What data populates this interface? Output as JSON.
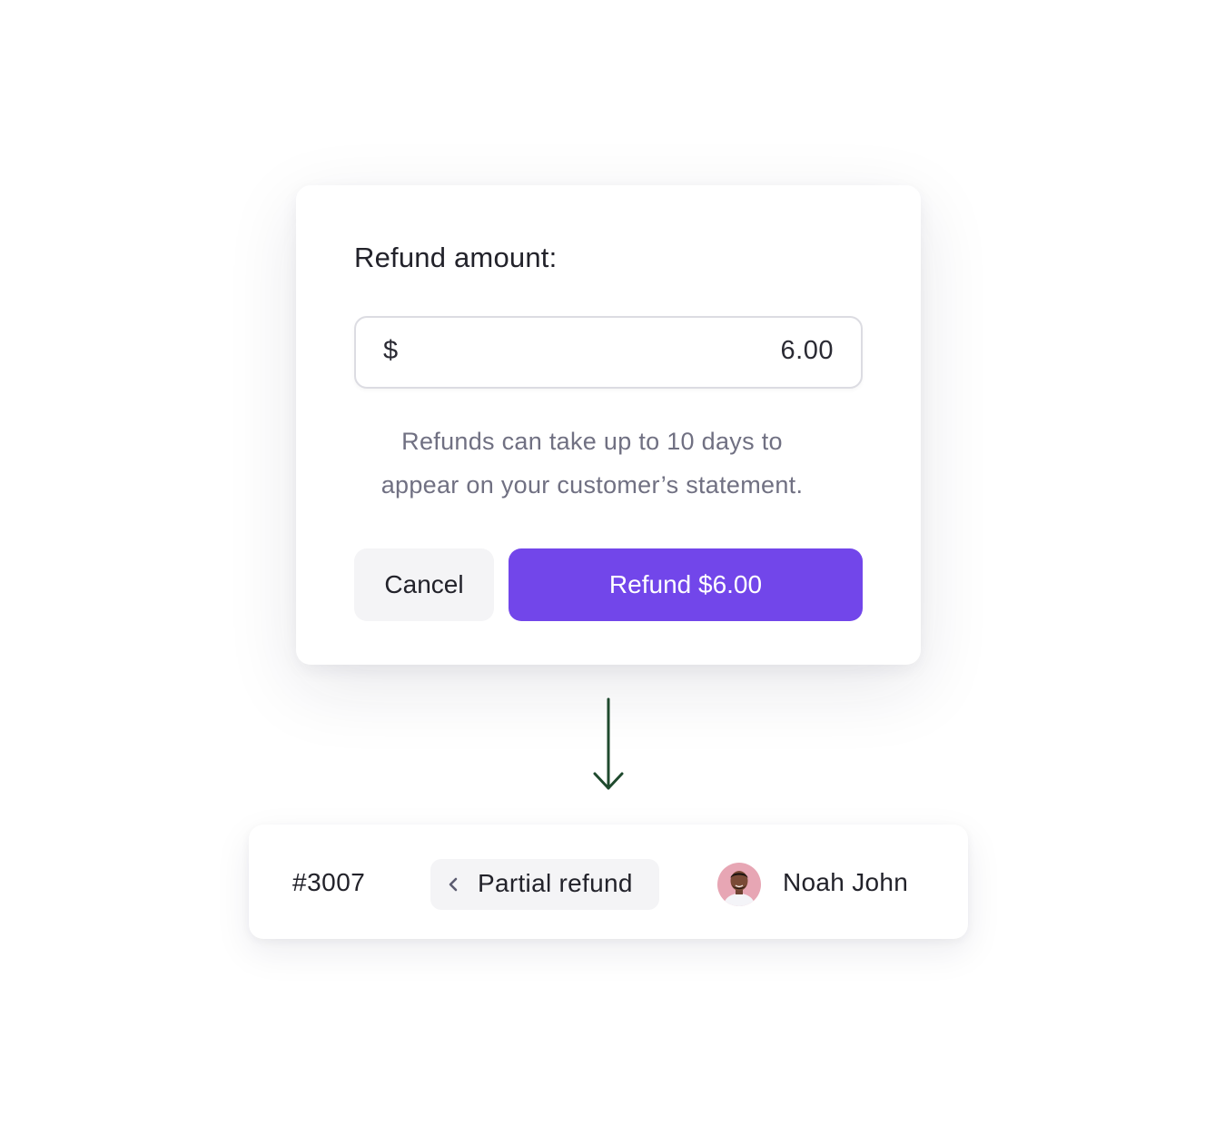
{
  "refund_dialog": {
    "title": "Refund amount:",
    "amount_field": {
      "currency_symbol": "$",
      "value": "6.00"
    },
    "hint_line_1": "Refunds can take up to 10 days to",
    "hint_line_2": "appear on your customer’s statement.",
    "cancel_label": "Cancel",
    "refund_label": "Refund $6.00",
    "accent_color": "#7246EA"
  },
  "flow_arrow": {
    "icon": "arrow-down-icon",
    "color": "#1F4A2E"
  },
  "order_row": {
    "order_id": "#3007",
    "status": {
      "icon": "chevron-left-icon",
      "label": "Partial refund"
    },
    "customer": {
      "avatar_icon": "avatar",
      "name": "Noah John"
    }
  }
}
